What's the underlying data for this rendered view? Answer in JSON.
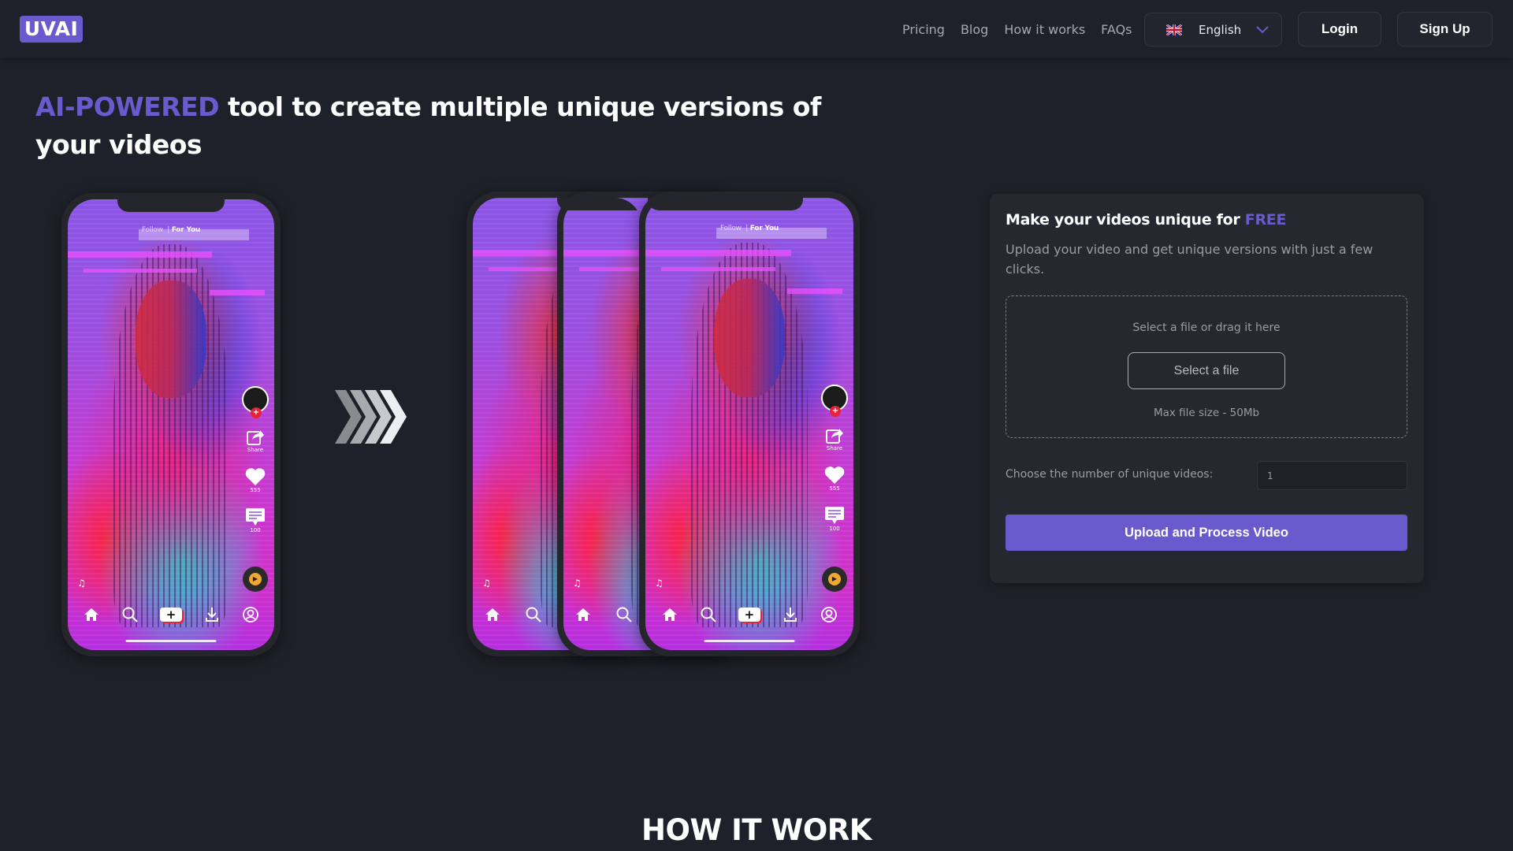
{
  "header": {
    "logo": "UVAI",
    "nav": [
      "Pricing",
      "Blog",
      "How it works",
      "FAQs"
    ],
    "language": {
      "selected": "English",
      "flag_icon": "uk-flag-icon"
    },
    "login_label": "Login",
    "signup_label": "Sign Up"
  },
  "hero": {
    "headline_accent": "AI-POWERED",
    "headline_rest": " tool to create multiple unique versions of your videos"
  },
  "phone_ui": {
    "tab_follow": "Follow",
    "tab_foryou": "For You",
    "share_label": "Share",
    "likes": "555",
    "comments": "100"
  },
  "upload_card": {
    "title": "Make your videos unique for ",
    "title_accent": "FREE",
    "subtitle": "Upload your video and get unique versions with just a few clicks.",
    "dropzone_text": "Select a file or drag it here",
    "select_button": "Select a file",
    "max_size": "Max file size - 50Mb",
    "count_label": "Choose the number of unique videos:",
    "count_value": "1",
    "process_button": "Upload and Process Video"
  },
  "how_it_works": {
    "title": "HOW IT WORK"
  },
  "colors": {
    "accent": "#6a5acd",
    "background": "#1f212a",
    "card": "#262830"
  }
}
